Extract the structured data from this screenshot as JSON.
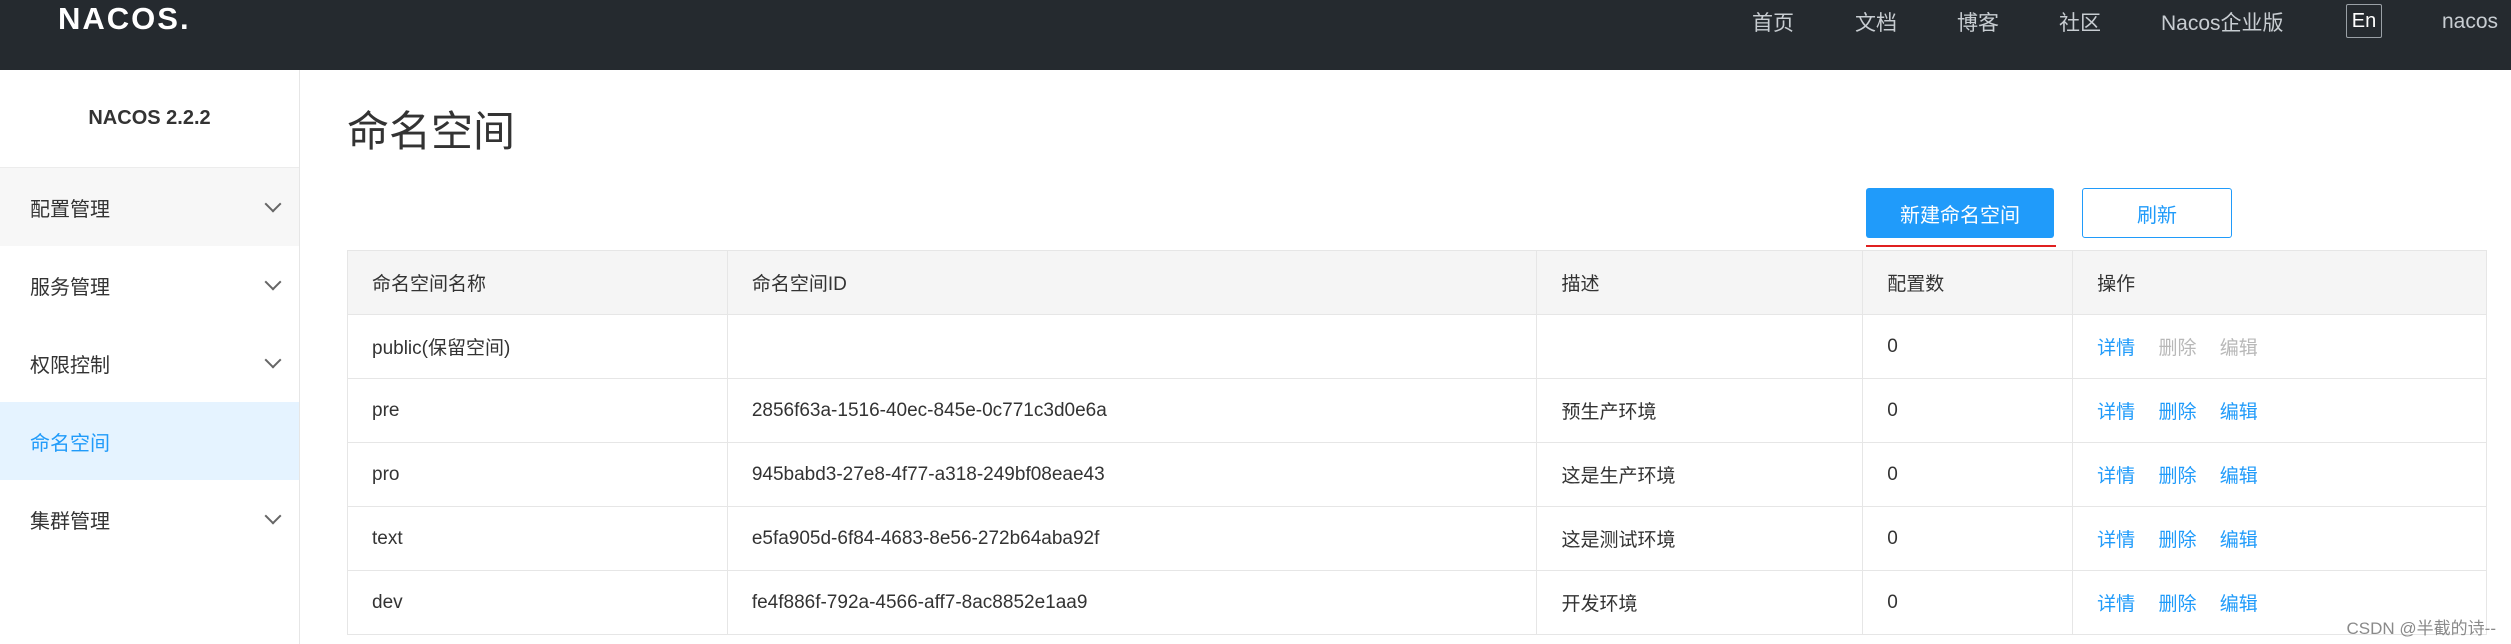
{
  "header": {
    "logo": "NACOS.",
    "nav": [
      "首页",
      "文档",
      "博客",
      "社区",
      "Nacos企业版"
    ],
    "lang": "En",
    "user": "nacos"
  },
  "sidebar": {
    "version": "NACOS 2.2.2",
    "items": [
      {
        "label": "配置管理",
        "has_chevron": true
      },
      {
        "label": "服务管理",
        "has_chevron": true
      },
      {
        "label": "权限控制",
        "has_chevron": true
      },
      {
        "label": "命名空间",
        "has_chevron": false,
        "active": true
      },
      {
        "label": "集群管理",
        "has_chevron": true
      }
    ]
  },
  "main": {
    "title": "命名空间",
    "new_button": "新建命名空间",
    "refresh_button": "刷新",
    "table": {
      "headers": [
        "命名空间名称",
        "命名空间ID",
        "描述",
        "配置数",
        "操作"
      ],
      "rows": [
        {
          "name": "public(保留空间)",
          "id": "",
          "desc": "",
          "count": "0",
          "actions": [
            "详情",
            "删除",
            "编辑"
          ],
          "readonly": true
        },
        {
          "name": "pre",
          "id": "2856f63a-1516-40ec-845e-0c771c3d0e6a",
          "desc": "预生产环境",
          "count": "0",
          "actions": [
            "详情",
            "删除",
            "编辑"
          ],
          "readonly": false
        },
        {
          "name": "pro",
          "id": "945babd3-27e8-4f77-a318-249bf08eae43",
          "desc": "这是生产环境",
          "count": "0",
          "actions": [
            "详情",
            "删除",
            "编辑"
          ],
          "readonly": false
        },
        {
          "name": "text",
          "id": "e5fa905d-6f84-4683-8e56-272b64aba92f",
          "desc": "这是测试环境",
          "count": "0",
          "actions": [
            "详情",
            "删除",
            "编辑"
          ],
          "readonly": false
        },
        {
          "name": "dev",
          "id": "fe4f886f-792a-4566-aff7-8ac8852e1aa9",
          "desc": "开发环境",
          "count": "0",
          "actions": [
            "详情",
            "删除",
            "编辑"
          ],
          "readonly": false
        }
      ]
    }
  },
  "watermark": "CSDN @半截的诗--",
  "colors": {
    "accent": "#209bfa",
    "header_bg": "#252a2f",
    "active_bg": "#e5f3ff",
    "underline": "#e02020"
  }
}
